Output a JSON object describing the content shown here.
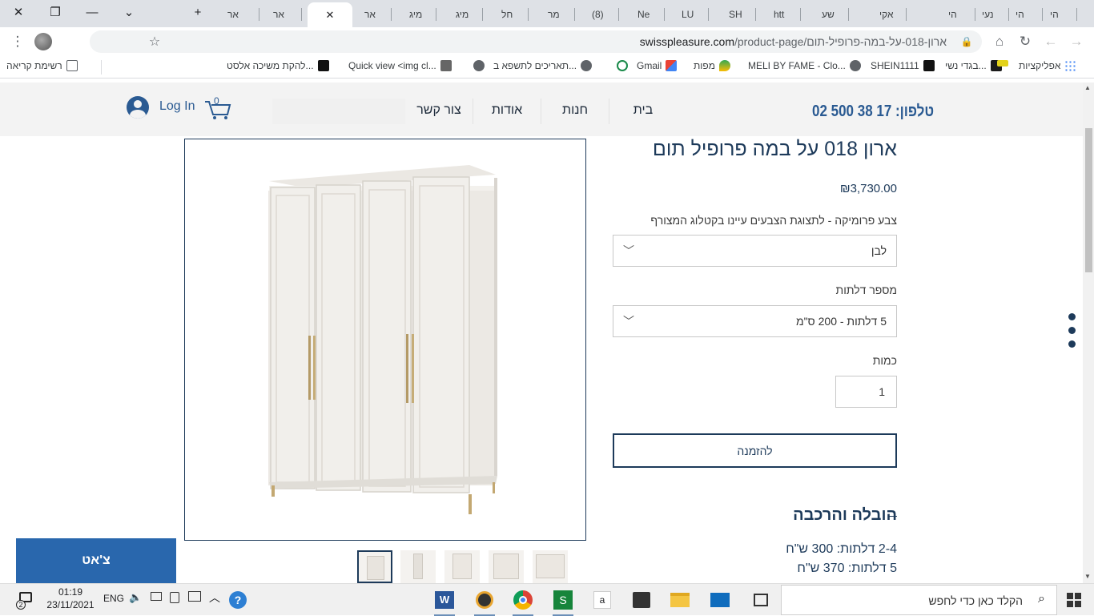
{
  "browser": {
    "tabs": [
      {
        "label": "הי"
      },
      {
        "label": "הי"
      },
      {
        "label": "נעי"
      },
      {
        "label": "הי"
      },
      {
        "label": "אקי"
      },
      {
        "label": "שע"
      },
      {
        "label": "htt"
      },
      {
        "label": "SH"
      },
      {
        "label": "LU"
      },
      {
        "label": "Ne"
      },
      {
        "label": "(8)"
      },
      {
        "label": "מר"
      },
      {
        "label": "חל"
      },
      {
        "label": "מיג"
      },
      {
        "label": "מיג"
      },
      {
        "label": "אר"
      },
      {
        "label": ""
      },
      {
        "label": "אר"
      },
      {
        "label": "אר"
      }
    ],
    "url_host": "swisspleasure.com",
    "url_path": "/product-page/ארון-018-על-במה-פרופיל-תום",
    "bookmarks": {
      "apps": "אפליקציות",
      "item1": "בגדי נשי...",
      "item2": "SHEIN1111",
      "item3": "MELI BY FAME - Clo...",
      "maps": "מפות",
      "gmail": "Gmail",
      "item4": "תאריכים לתשפא ב...",
      "item5": "Quick view <img cl...",
      "item6": "להקת משיכה אלסט...",
      "reading_list": "רשימת קריאה"
    }
  },
  "site": {
    "phone": "טלפון: 17 38 500 02",
    "nav": [
      "בית",
      "חנות",
      "אודות",
      "צור קשר"
    ],
    "cart_count": "0",
    "login": "Log In"
  },
  "product": {
    "title": "ארון 018 על במה פרופיל תום",
    "price": "₪3,730.00",
    "color_label": "צבע פרומיקה - לתצוגת הצבעים עיינו בקטלוג המצורף",
    "color_value": "לבן",
    "doors_label": "מספר דלתות",
    "doors_value": "5 דלתות - 200 ס\"מ",
    "qty_label": "כמות",
    "qty_value": "1",
    "order_button": "להזמנה",
    "delivery_title": "הובלה והרכבה",
    "delivery_lines": [
      "2-4 דלתות: 300 ש\"ח",
      "5 דלתות: 370 ש\"ח"
    ]
  },
  "chat": {
    "label": "צ'אט"
  },
  "taskbar": {
    "search_placeholder": "הקלד כאן כדי לחפש",
    "time": "01:19",
    "date": "23/11/2021",
    "lang": "ENG",
    "notif_count": "2"
  },
  "colors": {
    "brand_blue": "#2967ad",
    "navy": "#1d3a5a",
    "header_bg": "#f3f3f3"
  }
}
